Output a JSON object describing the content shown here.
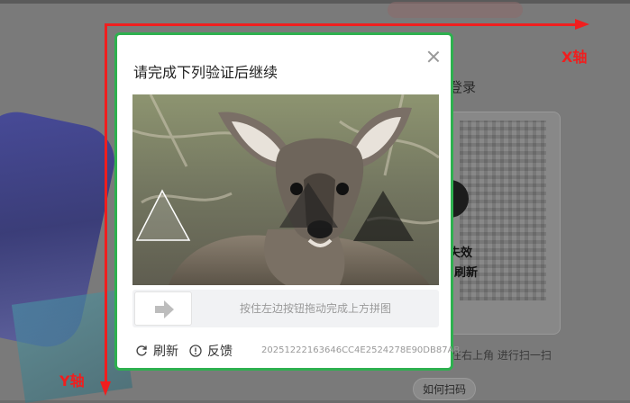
{
  "background": {
    "login_title": "登录",
    "qr_status_line1": "失效",
    "qr_status_line2": "刷新",
    "qr_hint": "在右上角  进行扫一扫",
    "how_to_scan": "如何扫码"
  },
  "dialog": {
    "title": "请完成下列验证后继续",
    "image_subject": "deer",
    "slider_hint": "按住左边按钮拖动完成上方拼图",
    "refresh_label": "刷新",
    "feedback_label": "反馈",
    "session_id": "20251222163646CC4E2524278E90DB87AB",
    "border_color": "#2eb04f"
  },
  "annotations": {
    "x_axis_label": "X轴",
    "y_axis_label": "Y轴",
    "color": "#f01e1e"
  }
}
